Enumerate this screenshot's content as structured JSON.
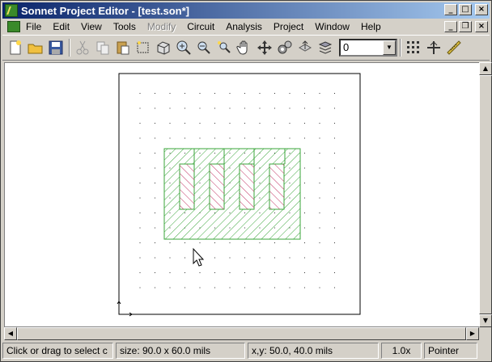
{
  "window": {
    "title": "Sonnet Project Editor - [test.son*]"
  },
  "menu": {
    "items": [
      {
        "label": "File",
        "enabled": true
      },
      {
        "label": "Edit",
        "enabled": true
      },
      {
        "label": "View",
        "enabled": true
      },
      {
        "label": "Tools",
        "enabled": true
      },
      {
        "label": "Modify",
        "enabled": false
      },
      {
        "label": "Circuit",
        "enabled": true
      },
      {
        "label": "Analysis",
        "enabled": true
      },
      {
        "label": "Project",
        "enabled": true
      },
      {
        "label": "Window",
        "enabled": true
      },
      {
        "label": "Help",
        "enabled": true
      }
    ]
  },
  "toolbar": {
    "icons": [
      "new-file-icon",
      "open-folder-icon",
      "save-icon",
      "cut-icon",
      "copy-icon",
      "paste-icon",
      "select-icon",
      "3d-view-icon",
      "zoom-in-icon",
      "zoom-out-icon",
      "zoom-fit-icon",
      "pan-hand-icon",
      "move-arrows-icon",
      "gears-icon",
      "level-up-icon",
      "level-stack-icon"
    ],
    "level_value": "0",
    "right_icons": [
      "grid-icon",
      "reference-plane-icon",
      "ruler-icon"
    ]
  },
  "status": {
    "hint": "Click or drag to select c",
    "size": "size: 90.0 x 60.0 mils",
    "coords": "x,y: 50.0, 40.0 mils",
    "zoom": "1.0x",
    "mode": "Pointer"
  },
  "colors": {
    "metal": "#3aa53a",
    "via": "#c03060",
    "title_start": "#0a246a",
    "title_end": "#a6caf0"
  }
}
